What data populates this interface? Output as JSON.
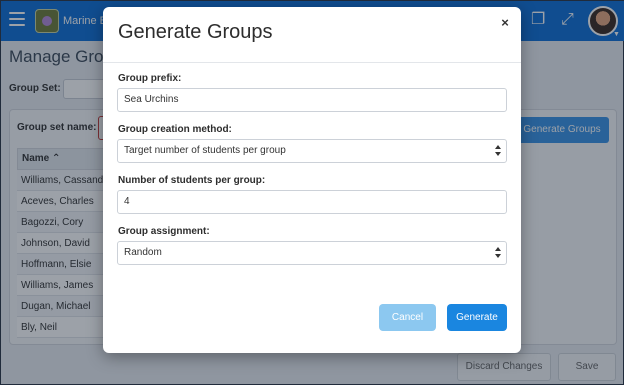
{
  "app": {
    "title": "Marine B",
    "page_title": "Manage Group",
    "group_set_label": "Group Set:",
    "group_set_name_label": "Group set name:",
    "generate_groups_button": "Generate Groups",
    "discard_button": "Discard Changes",
    "save_button": "Save",
    "table": {
      "header": "Name",
      "rows": [
        "Williams, Cassandra",
        "Aceves, Charles",
        "Bagozzi, Cory",
        "Johnson, David",
        "Hoffmann, Elsie",
        "Williams, James",
        "Dugan, Michael",
        "Bly, Neil"
      ]
    },
    "colors": {
      "topbar": "#0e6fd6",
      "primary": "#1a86e0",
      "primary_light": "#8cc8f0"
    }
  },
  "modal": {
    "title": "Generate Groups",
    "close_icon": "×",
    "fields": {
      "prefix_label": "Group prefix:",
      "prefix_value": "Sea Urchins",
      "method_label": "Group creation method:",
      "method_value": "Target number of students per group",
      "students_label": "Number of students per group:",
      "students_value": "4",
      "assignment_label": "Group assignment:",
      "assignment_value": "Random"
    },
    "cancel_button": "Cancel",
    "generate_button": "Generate"
  }
}
